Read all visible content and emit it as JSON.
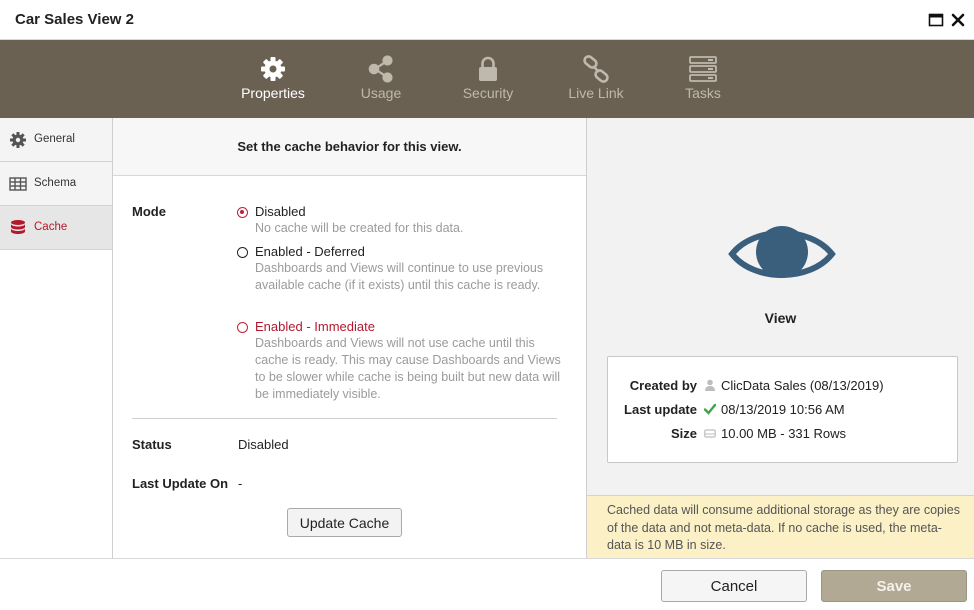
{
  "window": {
    "title": "Car Sales View 2",
    "maximize_icon": "maximize-icon",
    "close_icon": "close-icon"
  },
  "topnav": {
    "tabs": [
      {
        "label": "Properties",
        "icon": "gear-icon",
        "active": true
      },
      {
        "label": "Usage",
        "icon": "share-icon",
        "active": false
      },
      {
        "label": "Security",
        "icon": "lock-icon",
        "active": false
      },
      {
        "label": "Live Link",
        "icon": "link-icon",
        "active": false
      },
      {
        "label": "Tasks",
        "icon": "tasks-icon",
        "active": false
      }
    ]
  },
  "sidebar": {
    "items": [
      {
        "label": "General",
        "icon": "gear-icon",
        "active": false
      },
      {
        "label": "Schema",
        "icon": "table-icon",
        "active": false
      },
      {
        "label": "Cache",
        "icon": "database-icon",
        "active": true
      }
    ]
  },
  "main": {
    "header": "Set the cache behavior for this view.",
    "mode_label": "Mode",
    "options": [
      {
        "label": "Disabled",
        "description": "No cache will be created for this data.",
        "checked": true
      },
      {
        "label": "Enabled - Deferred",
        "description": "Dashboards and Views will continue to use previous available cache (if it exists) until this cache is ready.",
        "checked": false
      },
      {
        "label": "Enabled - Immediate",
        "description": "Dashboards and Views will not use cache until this cache is ready. This may cause Dashboards and Views to be slower while cache is being built but new data will be immediately visible.",
        "checked": false
      }
    ],
    "status_label": "Status",
    "status_value": "Disabled",
    "last_update_label": "Last Update On",
    "last_update_value": "-",
    "update_button": "Update Cache"
  },
  "right": {
    "view_label": "View",
    "info": {
      "created_by_label": "Created by",
      "created_by_value": "ClicData Sales (08/13/2019)",
      "last_update_label": "Last update",
      "last_update_value": "08/13/2019 10:56 AM",
      "size_label": "Size",
      "size_value": "10.00 MB - 331 Rows"
    },
    "notice": "Cached data will consume additional storage as they are copies of the data and not meta-data. If no cache is used, the meta-data is 10 MB in size."
  },
  "footer": {
    "cancel": "Cancel",
    "save": "Save"
  },
  "colors": {
    "nav_bg": "#6b6153",
    "accent_red": "#b3192e",
    "eye_blue": "#3a5f7d",
    "save_bg": "#b1a994",
    "notice_bg": "#fbf0c6"
  }
}
